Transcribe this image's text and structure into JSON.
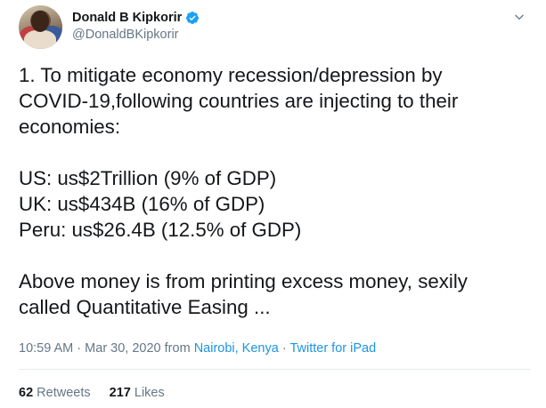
{
  "author": {
    "display_name": "Donald B Kipkorir",
    "handle": "@DonaldBKipkorir",
    "verified": true
  },
  "tweet": {
    "lines": [
      "1. To mitigate economy recession/depression by",
      "COVID-19,following countries are injecting to their",
      "economies:",
      "",
      "US: us$2Trillion (9% of GDP)",
      "UK: us$434B (16% of GDP)",
      "Peru: us$26.4B (12.5% of GDP)",
      "",
      "Above money is from printing excess money, sexily",
      "called Quantitative Easing ..."
    ]
  },
  "meta": {
    "time": "10:59 AM",
    "date": "Mar 30, 2020",
    "from_label": "from",
    "location": "Nairobi, Kenya",
    "source": "Twitter for iPad",
    "separator": "·"
  },
  "stats": {
    "retweets_count": "62",
    "retweets_label": "Retweets",
    "likes_count": "217",
    "likes_label": "Likes"
  },
  "icons": {
    "verified": "verified-badge-icon",
    "caret": "chevron-down-icon"
  },
  "colors": {
    "text": "#14171a",
    "secondary": "#657786",
    "link": "#1b95e0",
    "verified": "#1da1f2",
    "divider": "#e6ecf0"
  }
}
